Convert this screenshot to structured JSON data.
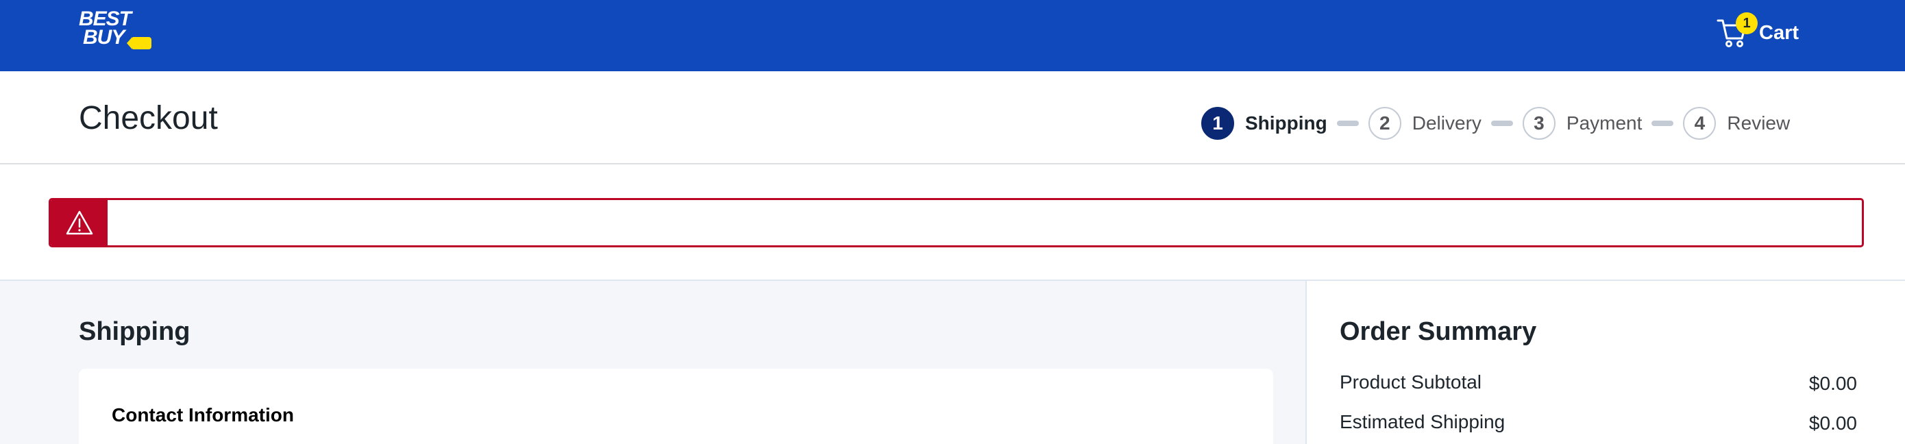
{
  "header": {
    "logo_text_line1": "BEST",
    "logo_text_line2": "BUY",
    "cart_label": "Cart",
    "cart_count": "1",
    "brand_color": "#1049bb",
    "accent_color": "#ffe000"
  },
  "checkout": {
    "title": "Checkout",
    "steps": [
      {
        "number": "1",
        "label": "Shipping",
        "active": true
      },
      {
        "number": "2",
        "label": "Delivery",
        "active": false
      },
      {
        "number": "3",
        "label": "Payment",
        "active": false
      },
      {
        "number": "4",
        "label": "Review",
        "active": false
      }
    ]
  },
  "alert": {
    "icon": "warning-triangle-icon",
    "message": "",
    "color": "#bb0628"
  },
  "shipping": {
    "title": "Shipping",
    "contact_title": "Contact Information"
  },
  "order_summary": {
    "title": "Order Summary",
    "rows": [
      {
        "label": "Product Subtotal",
        "value": "$0.00"
      },
      {
        "label": "Estimated Shipping",
        "value": "$0.00"
      }
    ]
  }
}
